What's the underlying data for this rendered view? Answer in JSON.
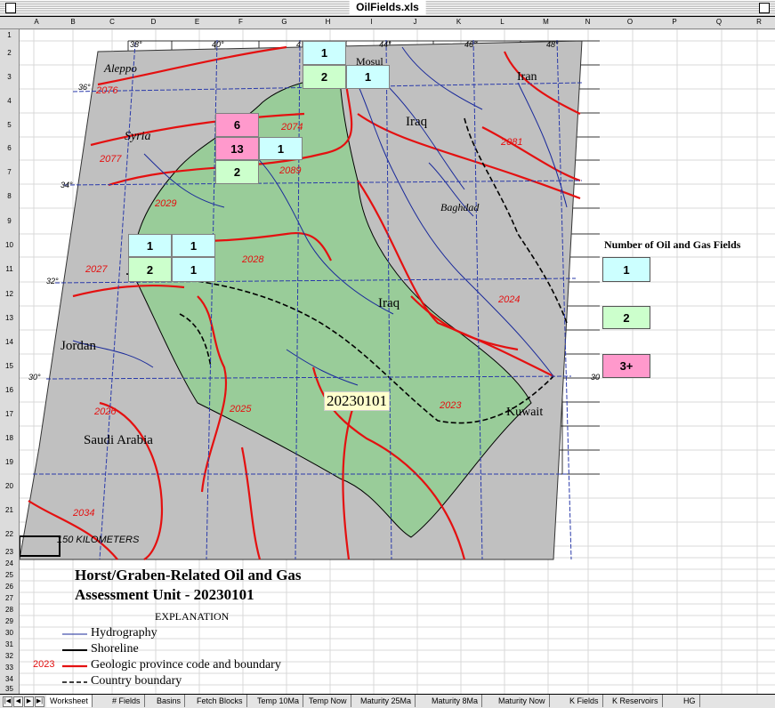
{
  "window": {
    "title": "OilFields.xls"
  },
  "columns": [
    "A",
    "B",
    "C",
    "D",
    "E",
    "F",
    "G",
    "H",
    "I",
    "J",
    "K",
    "L",
    "M",
    "N",
    "O",
    "P",
    "Q",
    "R"
  ],
  "rows": [
    "1",
    "2",
    "3",
    "4",
    "5",
    "6",
    "7",
    "8",
    "9",
    "10",
    "11",
    "12",
    "13",
    "14",
    "15",
    "16",
    "17",
    "18",
    "19",
    "20",
    "21",
    "22",
    "23",
    "24",
    "25",
    "26",
    "27",
    "28",
    "29",
    "30",
    "31",
    "32",
    "33",
    "34",
    "35"
  ],
  "map": {
    "places": {
      "aleppo": "Aleppo",
      "mosul": "Mosul",
      "iran": "Iran",
      "syria": "Syria",
      "iraq_n": "Iraq",
      "baghdad": "Baghdad",
      "iraq_s": "Iraq",
      "jordan": "Jordan",
      "saudi": "Saudi Arabia",
      "kuwait": "Kuwait"
    },
    "codes": [
      "2076",
      "2074",
      "2081",
      "2077",
      "2089",
      "2029",
      "2028",
      "2027",
      "2024",
      "2026",
      "2025",
      "2023",
      "2034"
    ],
    "latlon": {
      "lon38": "38°",
      "lon40": "40°",
      "lon42": "4",
      "lon44": "44°",
      "lon46": "46°",
      "lon48": "48°",
      "lat36": "36°",
      "lat34": "34°",
      "lat32": "32°",
      "lat30": "30°",
      "lat30r": "30"
    },
    "unit_label": "20230101",
    "scale_label": "150 KILOMETERS"
  },
  "field_cells": [
    {
      "id": "h2",
      "value": "1",
      "level": "1"
    },
    {
      "id": "h3",
      "value": "2",
      "level": "2"
    },
    {
      "id": "i3",
      "value": "1",
      "level": "1"
    },
    {
      "id": "f5",
      "value": "6",
      "level": "3"
    },
    {
      "id": "f6",
      "value": "13",
      "level": "3"
    },
    {
      "id": "g6",
      "value": "1",
      "level": "1"
    },
    {
      "id": "f7",
      "value": "2",
      "level": "2"
    },
    {
      "id": "d10",
      "value": "1",
      "level": "1"
    },
    {
      "id": "e10",
      "value": "1",
      "level": "1"
    },
    {
      "id": "d11",
      "value": "2",
      "level": "2"
    },
    {
      "id": "e11",
      "value": "1",
      "level": "1"
    }
  ],
  "legend": {
    "title": "Number of Oil and Gas Fields",
    "items": [
      {
        "label": "1",
        "color": "#ccffff"
      },
      {
        "label": "2",
        "color": "#ccffcc"
      },
      {
        "label": "3+",
        "color": "#ff99cc"
      }
    ]
  },
  "heading": {
    "line1": "Horst/Graben-Related Oil and Gas",
    "line2": "Assessment Unit - 20230101"
  },
  "explanation": {
    "title": "EXPLANATION",
    "code_sample": "2023",
    "items": [
      "Hydrography",
      "Shoreline",
      "Geologic province code and boundary",
      "Country boundary"
    ]
  },
  "colors": {
    "level1": "#ccffff",
    "level2": "#ccffcc",
    "level3": "#ff99cc",
    "au_fill": "#99cc99",
    "map_bg": "#c0c0c0",
    "province": "#e41010",
    "river": "#1a2a9a"
  },
  "sheet_tabs": [
    "Worksheet",
    "# Fields",
    "Basins",
    "Fetch Blocks",
    "Temp 10Ma",
    "Temp Now",
    "Maturity 25Ma",
    "Maturity 8Ma",
    "Maturity Now",
    "K Fields",
    "K Reservoirs",
    "HG"
  ]
}
